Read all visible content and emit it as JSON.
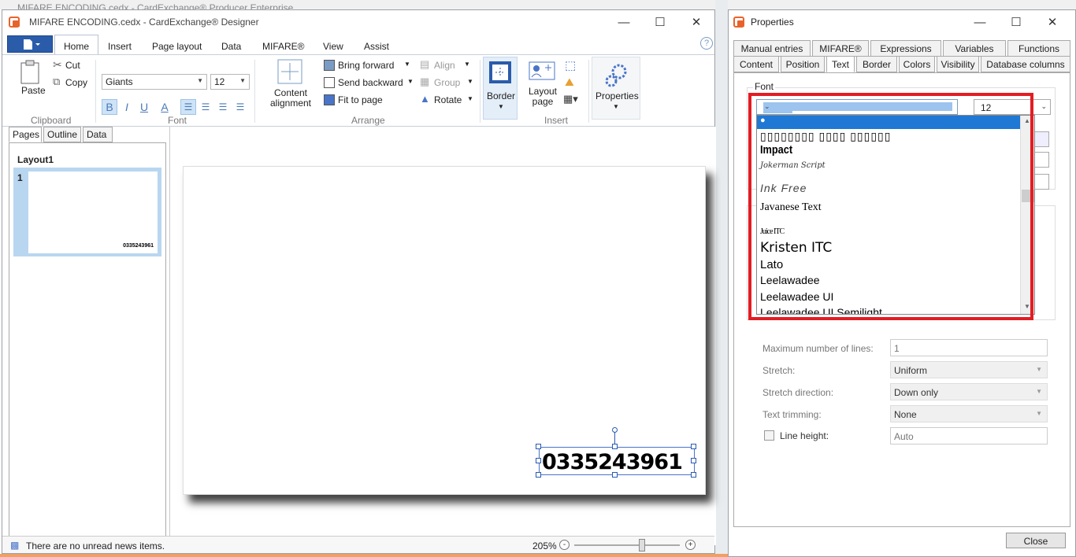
{
  "background": {
    "title": "MIFARE ENCODING.cedx - CardExchange® Producer Enterprise"
  },
  "designer": {
    "title": "MIFARE ENCODING.cedx - CardExchange® Designer",
    "tabs": [
      "Home",
      "Insert",
      "Page layout",
      "Data",
      "MIFARE®",
      "View",
      "Assist"
    ],
    "clipboard": {
      "paste": "Paste",
      "cut": "Cut",
      "copy": "Copy",
      "label": "Clipboard"
    },
    "font": {
      "family": "Giants",
      "size": "12",
      "label": "Font",
      "bold": "B",
      "italic": "I",
      "underline": "U",
      "color": "A"
    },
    "content_alignment": "Content alignment",
    "arrange": {
      "bring_forward": "Bring forward",
      "send_backward": "Send backward",
      "fit_to_page": "Fit to page",
      "align": "Align",
      "group": "Group",
      "rotate": "Rotate",
      "label": "Arrange"
    },
    "insert": {
      "border": "Border",
      "layout_page": "Layout page",
      "label": "Insert"
    },
    "properties_btn": "Properties",
    "help": "?",
    "left_tabs": [
      "Pages",
      "Outline",
      "Data"
    ],
    "layout_name": "Layout1",
    "page_number": "1",
    "card_text": "0335243961",
    "status": "There are no unread news items.",
    "zoom": "205%"
  },
  "properties": {
    "title": "Properties",
    "tabs_row1": [
      "Manual entries",
      "MIFARE®",
      "Expressions",
      "Variables",
      "Functions"
    ],
    "tabs_row2": [
      "Content",
      "Position",
      "Text",
      "Border",
      "Colors",
      "Visibility",
      "Database columns"
    ],
    "font_label": "Font",
    "font_value": "Giants",
    "size_value": "12",
    "font_list": [
      {
        "label": "●",
        "selected": true
      },
      {
        "label": "▯▯▯▯▯▯▯▯ ▯▯▯▯ ▯▯▯▯▯▯"
      },
      {
        "label": "Impact"
      },
      {
        "label": "Jokerman Script"
      },
      {
        "label": "Ink Free"
      },
      {
        "label": "Javanese Text"
      },
      {
        "label": "Juice ITC"
      },
      {
        "label": "Kristen ITC"
      },
      {
        "label": "Lato"
      },
      {
        "label": "Leelawadee"
      },
      {
        "label": "Leelawadee UI"
      },
      {
        "label": "Leelawadee UI Semilight"
      }
    ],
    "max_lines_label": "Maximum number of lines:",
    "max_lines_value": "1",
    "stretch_label": "Stretch:",
    "stretch_value": "Uniform",
    "stretch_dir_label": "Stretch direction:",
    "stretch_dir_value": "Down only",
    "trim_label": "Text trimming:",
    "trim_value": "None",
    "line_height_label": "Line height:",
    "line_height_placeholder": "Auto",
    "close": "Close"
  },
  "colors": {
    "highlight": "#e31c23",
    "selection": "#1e78d4",
    "file_button": "#2a5caa"
  }
}
